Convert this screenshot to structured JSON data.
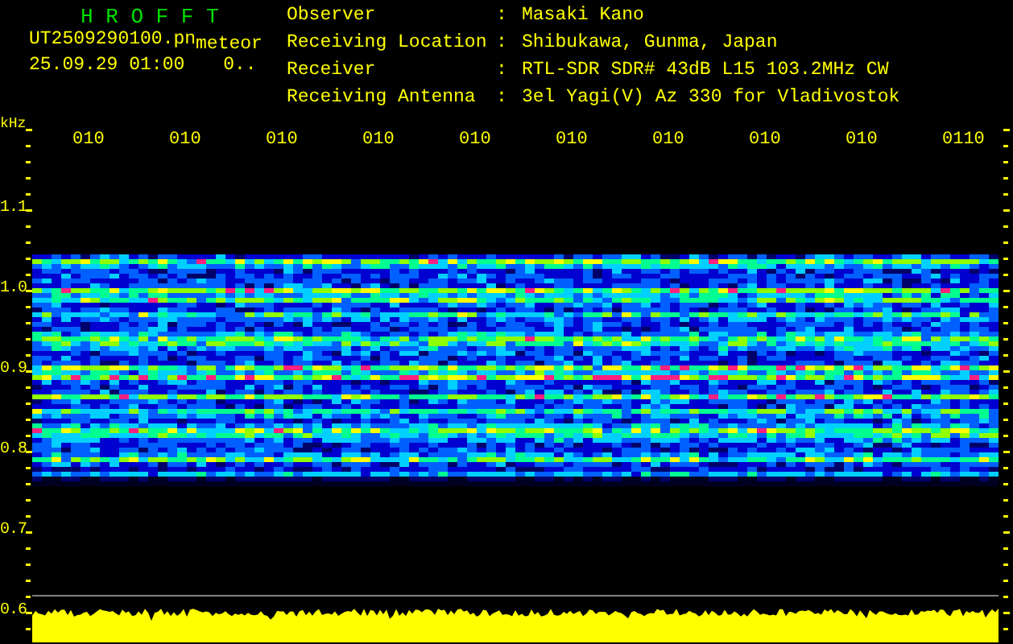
{
  "app_title": "H R O F F T",
  "file_name": "UT2509290100.pn",
  "mode": "meteor",
  "date_time": "25.09.29 01:00",
  "count": "0..",
  "station_info": [
    {
      "label": "Observer",
      "separator": ":",
      "value": "Masaki Kano"
    },
    {
      "label": "Receiving Location",
      "separator": ":",
      "value": "Shibukawa, Gunma, Japan"
    },
    {
      "label": "Receiver",
      "separator": ":",
      "value": "RTL-SDR SDR# 43dB L15 103.2MHz CW"
    },
    {
      "label": "Receiving Antenna",
      "separator": ":",
      "value": "3el Yagi(V) Az 330 for Vladivostok"
    }
  ],
  "time_axis": {
    "labels": [
      "010",
      "010",
      "010",
      "010",
      "010",
      "010",
      "010",
      "010",
      "010",
      "0110"
    ]
  },
  "frequency_axis": {
    "unit": "kHz",
    "labels": [
      "1.1",
      "1.0",
      "0.9",
      "0.8",
      "0.7",
      "0.6"
    ]
  }
}
